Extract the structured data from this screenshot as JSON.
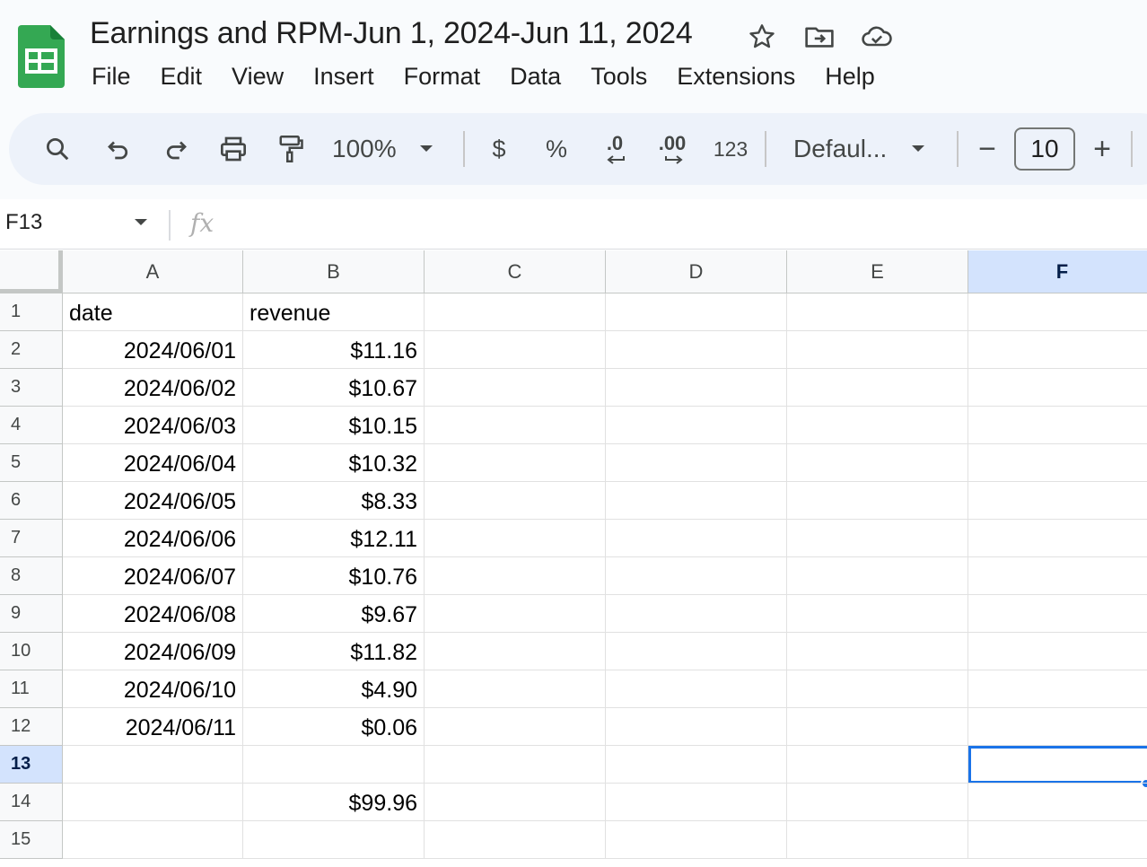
{
  "document": {
    "title": "Earnings and RPM-Jun 1, 2024-Jun 11, 2024"
  },
  "menu": [
    "File",
    "Edit",
    "View",
    "Insert",
    "Format",
    "Data",
    "Tools",
    "Extensions",
    "Help"
  ],
  "toolbar": {
    "zoom": "100%",
    "currency_label": "$",
    "percent_label": "%",
    "decrease_decimal_label": ".0",
    "increase_decimal_label": ".00",
    "number_format_label": "123",
    "font_name": "Defaul...",
    "font_size": "10",
    "minus_label": "−",
    "plus_label": "+"
  },
  "formula_bar": {
    "cell_ref": "F13",
    "fx_label": "fx",
    "formula": ""
  },
  "columns": [
    "A",
    "B",
    "C",
    "D",
    "E",
    "F"
  ],
  "selected_column": "F",
  "selected_row": "13",
  "rows": [
    {
      "num": "1",
      "a": "date",
      "b": "revenue"
    },
    {
      "num": "2",
      "a": "2024/06/01",
      "b": "$11.16"
    },
    {
      "num": "3",
      "a": "2024/06/02",
      "b": "$10.67"
    },
    {
      "num": "4",
      "a": "2024/06/03",
      "b": "$10.15"
    },
    {
      "num": "5",
      "a": "2024/06/04",
      "b": "$10.32"
    },
    {
      "num": "6",
      "a": "2024/06/05",
      "b": "$8.33"
    },
    {
      "num": "7",
      "a": "2024/06/06",
      "b": "$12.11"
    },
    {
      "num": "8",
      "a": "2024/06/07",
      "b": "$10.76"
    },
    {
      "num": "9",
      "a": "2024/06/08",
      "b": "$9.67"
    },
    {
      "num": "10",
      "a": "2024/06/09",
      "b": "$11.82"
    },
    {
      "num": "11",
      "a": "2024/06/10",
      "b": "$4.90"
    },
    {
      "num": "12",
      "a": "2024/06/11",
      "b": "$0.06"
    },
    {
      "num": "13",
      "a": "",
      "b": ""
    },
    {
      "num": "14",
      "a": "",
      "b": "$99.96"
    },
    {
      "num": "15",
      "a": "",
      "b": ""
    }
  ],
  "colors": {
    "accent": "#1a73e8",
    "selected_header_bg": "#d3e3fd",
    "toolbar_bg": "#edf2fa",
    "sheets_green": "#34a853"
  }
}
